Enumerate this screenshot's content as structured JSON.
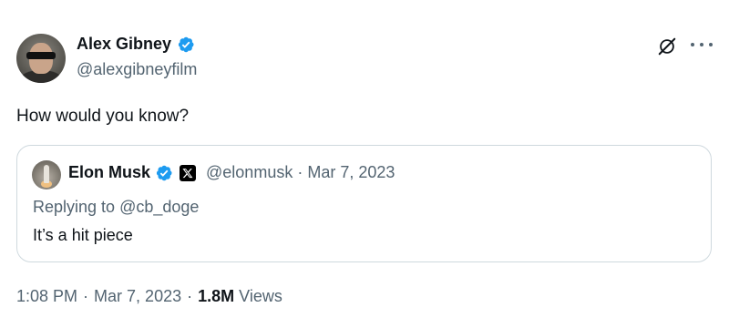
{
  "tweet": {
    "author": {
      "display_name": "Alex Gibney",
      "handle": "@alexgibneyfilm",
      "verified": true
    },
    "text": "How would you know?",
    "icons": {
      "grok": "grok-icon",
      "more": "more-icon"
    },
    "quote": {
      "author": {
        "display_name": "Elon Musk",
        "handle": "@elonmusk",
        "verified": true,
        "affiliate_badge": "x-logo-icon"
      },
      "separator": "·",
      "date": "Mar 7, 2023",
      "replying_prefix": "Replying to",
      "replying_to": "@cb_doge",
      "text": "It’s a hit piece"
    },
    "footer": {
      "time": "1:08 PM",
      "separator": "·",
      "date": "Mar 7, 2023",
      "views_count": "1.8M",
      "views_label": "Views"
    }
  },
  "colors": {
    "verified_blue": "#1d9bf0",
    "text_primary": "#0f1419",
    "text_secondary": "#536471",
    "border": "#cfd9de"
  }
}
